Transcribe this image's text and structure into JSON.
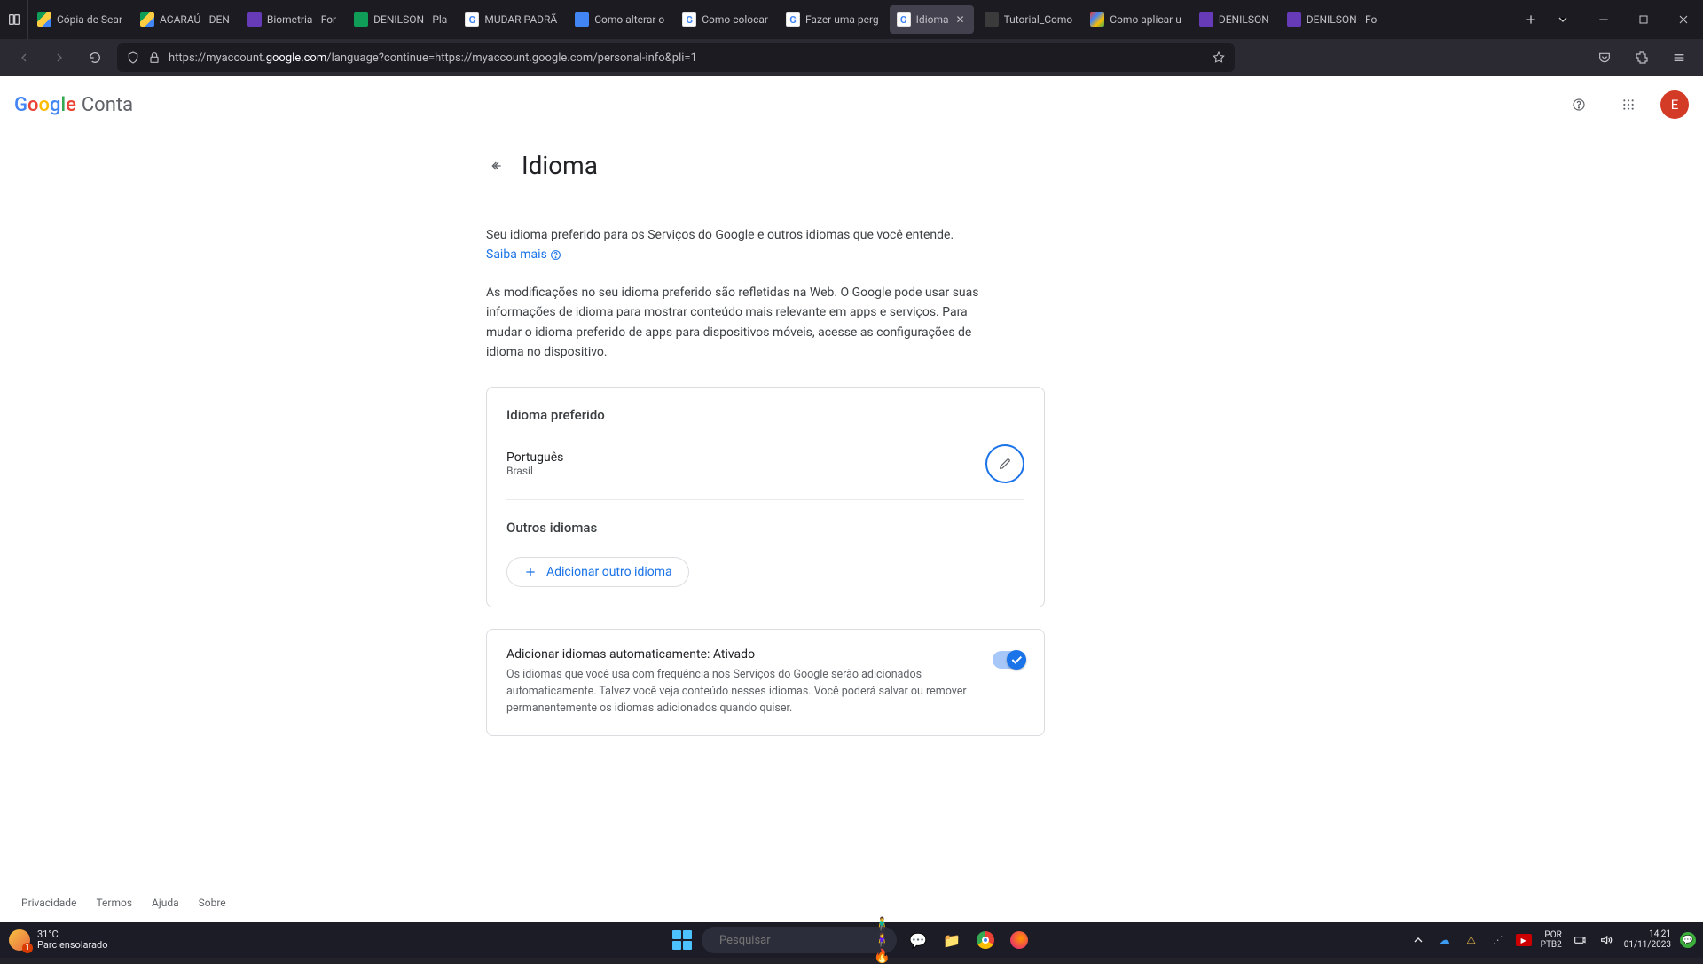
{
  "browser": {
    "tabs": [
      {
        "label": "Cópia de Sear"
      },
      {
        "label": "ACARAÚ - DEN"
      },
      {
        "label": "Biometria - For"
      },
      {
        "label": "DENILSON - Pla"
      },
      {
        "label": "MUDAR PADRÃ"
      },
      {
        "label": "Como alterar o"
      },
      {
        "label": "Como colocar"
      },
      {
        "label": "Fazer uma perg"
      },
      {
        "label": "Idioma"
      },
      {
        "label": "Tutorial_Como"
      },
      {
        "label": "Como aplicar u"
      },
      {
        "label": "DENILSON"
      },
      {
        "label": "DENILSON - Fo"
      }
    ],
    "url_prefix": "https://myaccount.",
    "url_domain": "google.com",
    "url_path": "/language?continue=https://myaccount.google.com/personal-info&pli=1"
  },
  "header": {
    "logo_word": "Conta",
    "avatar_letter": "E"
  },
  "page": {
    "title": "Idioma",
    "intro_text": "Seu idioma preferido para os Serviços do Google e outros idiomas que você entende. ",
    "learn_more": "Saiba mais",
    "paragraph": "As modificações no seu idioma preferido são refletidas na Web. O Google pode usar suas informações de idioma para mostrar conteúdo mais rele­vante em apps e serviços. Para mudar o idioma preferido de apps para dis­positivos móveis, acesse as configurações de idioma no dispositivo.",
    "preferred_heading": "Idioma preferido",
    "language_name": "Português",
    "language_region": "Brasil",
    "other_heading": "Outros idiomas",
    "add_other": "Adicionar outro idioma",
    "auto_title": "Adicionar idiomas automaticamente: Ativado",
    "auto_desc": "Os idiomas que você usa com frequência nos Serviços do Google serão adicio­nados automaticamente. Talvez você veja conteúdo nesses idiomas. Você pode­rá salvar ou remover permanentemente os idiomas adicionados quando quiser."
  },
  "footer": {
    "privacy": "Privacidade",
    "terms": "Termos",
    "help": "Ajuda",
    "about": "Sobre"
  },
  "taskbar": {
    "temp": "31°C",
    "weather_desc": "Parc ensolarado",
    "search_placeholder": "Pesquisar",
    "lang1": "POR",
    "lang2": "PTB2",
    "time": "14:21",
    "date": "01/11/2023"
  }
}
